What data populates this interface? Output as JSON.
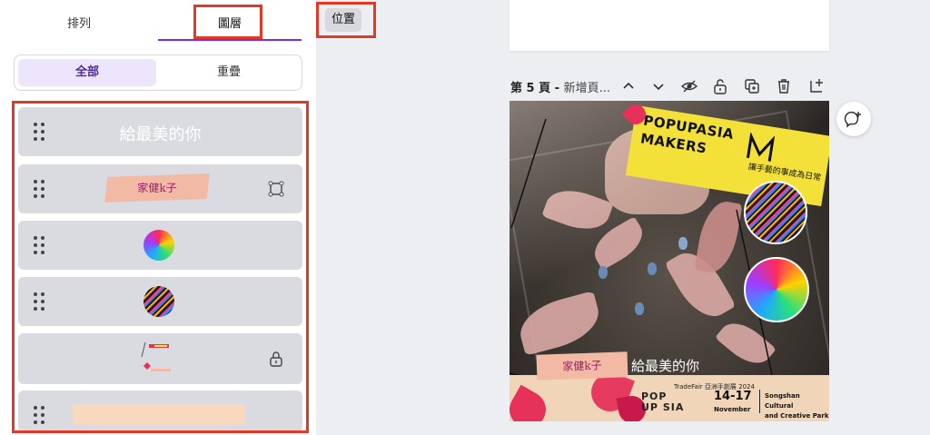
{
  "left_panel": {
    "tabs": {
      "arrange": "排列",
      "layers": "圖層"
    },
    "filter": {
      "all": "全部",
      "overlap": "重疊"
    },
    "layers": [
      {
        "type": "text",
        "label": "給最美的你"
      },
      {
        "type": "image",
        "label": "家健k子",
        "icon": "crop-frame-icon"
      },
      {
        "type": "image",
        "icon": "rainbow-yarn-thumbnail"
      },
      {
        "type": "image",
        "icon": "crochet-hooks-thumbnail"
      },
      {
        "type": "group",
        "icon": "lock-icon"
      },
      {
        "type": "shape",
        "icon": "peach-rectangle"
      }
    ]
  },
  "top_bar": {
    "position_button": "位置"
  },
  "page_header": {
    "page_number": "第 5 頁",
    "separator": " - ",
    "title": "新增頁...",
    "tools": [
      "chevron-up-icon",
      "chevron-down-icon",
      "hide-icon",
      "unlock-icon",
      "duplicate-icon",
      "delete-icon",
      "add-page-icon"
    ]
  },
  "design": {
    "banner_line1": "POPUPASIA",
    "banner_line2": "MAKERS",
    "banner_cn": "讓手藝的事成為日常",
    "tape_text": "家健k子",
    "caption": "給最美的你",
    "footer": {
      "pop": "POP",
      "upsia": "UP SIA",
      "tradefair": "TradeFair 亞洲手創展 2024",
      "dates": "14-17",
      "month": "November",
      "venue_line1": "Songshan Cultural",
      "venue_line2": "and Creative Park"
    }
  },
  "colors": {
    "accent": "#7d2ae8",
    "highlight": "#e03a24",
    "layer_bg": "#d9dbe0",
    "banner": "#f3e13a"
  }
}
